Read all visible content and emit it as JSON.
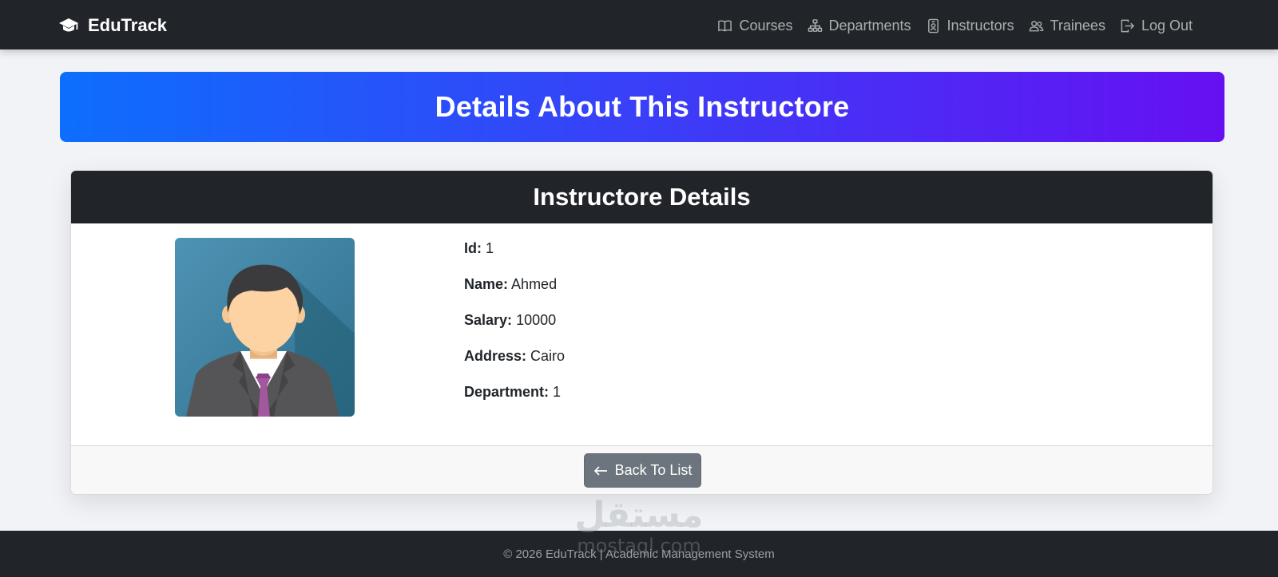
{
  "brand": {
    "name": "EduTrack",
    "icon": "graduation-cap-icon"
  },
  "nav": {
    "items": [
      {
        "label": "Courses",
        "icon": "book-icon"
      },
      {
        "label": "Departments",
        "icon": "sitemap-icon"
      },
      {
        "label": "Instructors",
        "icon": "person-badge-icon"
      },
      {
        "label": "Trainees",
        "icon": "people-icon"
      },
      {
        "label": "Log Out",
        "icon": "logout-icon"
      }
    ]
  },
  "hero": {
    "title": "Details About This Instructore"
  },
  "card": {
    "title": "Instructore Details",
    "fields": [
      {
        "label": "Id:",
        "value": "1"
      },
      {
        "label": "Name:",
        "value": "Ahmed"
      },
      {
        "label": "Salary:",
        "value": "10000"
      },
      {
        "label": "Address:",
        "value": "Cairo"
      },
      {
        "label": "Department:",
        "value": "1"
      }
    ],
    "back_label": "Back To List"
  },
  "footer": {
    "text": "© 2026 EduTrack | Academic Management System"
  },
  "watermark": {
    "arabic": "مستقل",
    "latin": "mostaql.com"
  },
  "colors": {
    "navbar": "#212529",
    "hero_gradient_start": "#0d6efd",
    "hero_gradient_end": "#6610f2",
    "button_secondary": "#6c757d"
  }
}
